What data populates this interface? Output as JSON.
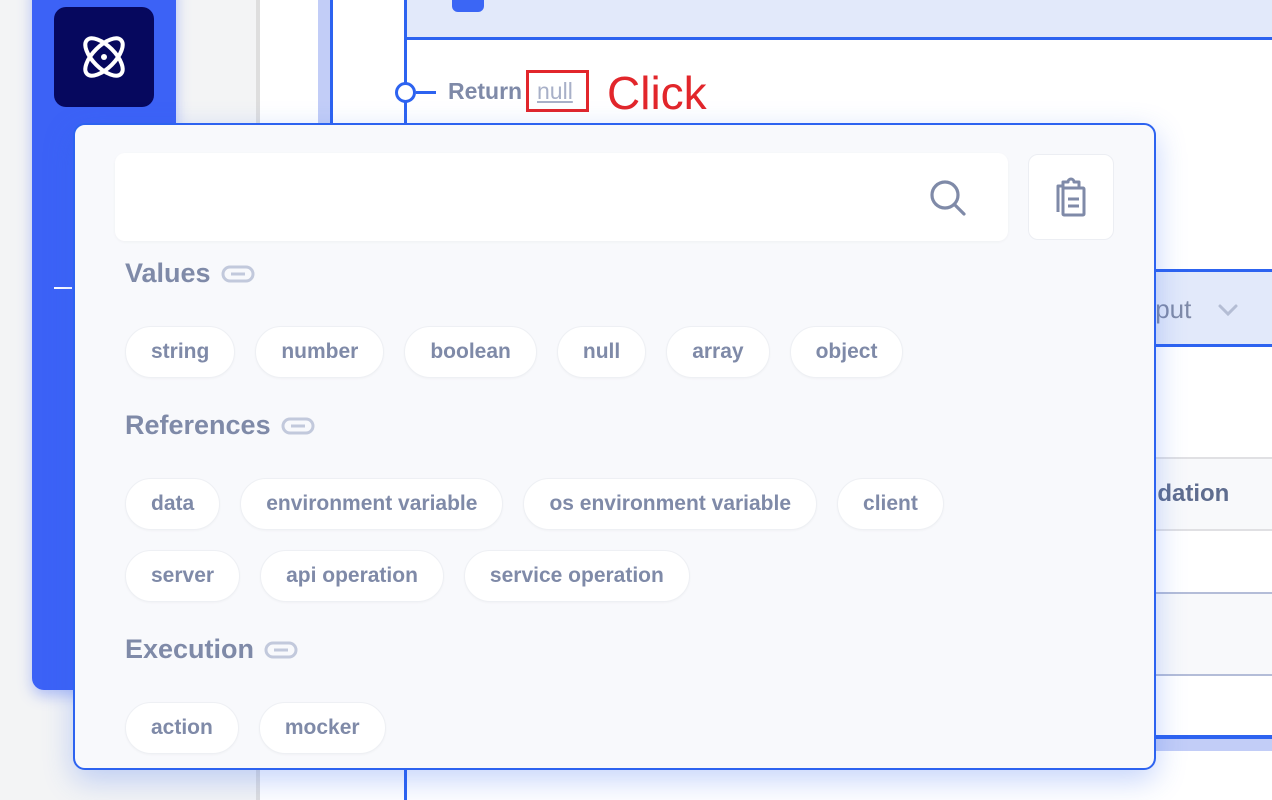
{
  "sidebar": {
    "logo_icon": "atom-icon"
  },
  "flow": {
    "return_label": "Return",
    "return_value": "null",
    "annotation": "Click"
  },
  "right_panel": {
    "output_label": "tput",
    "table_header": "lidation"
  },
  "popover": {
    "search": {
      "value": "",
      "placeholder": ""
    },
    "clipboard_icon": "clipboard-icon",
    "sections": [
      {
        "title": "Values",
        "items": [
          "string",
          "number",
          "boolean",
          "null",
          "array",
          "object"
        ]
      },
      {
        "title": "References",
        "items": [
          "data",
          "environment variable",
          "os environment variable",
          "client",
          "server",
          "api operation",
          "service operation"
        ]
      },
      {
        "title": "Execution",
        "items": [
          "action",
          "mocker"
        ]
      }
    ]
  },
  "colors": {
    "accent": "#2d63f0",
    "sidebar": "#3c62f6",
    "logo_bg": "#06085e",
    "muted_text": "#7f8aa8",
    "annotation": "#e2262b"
  }
}
